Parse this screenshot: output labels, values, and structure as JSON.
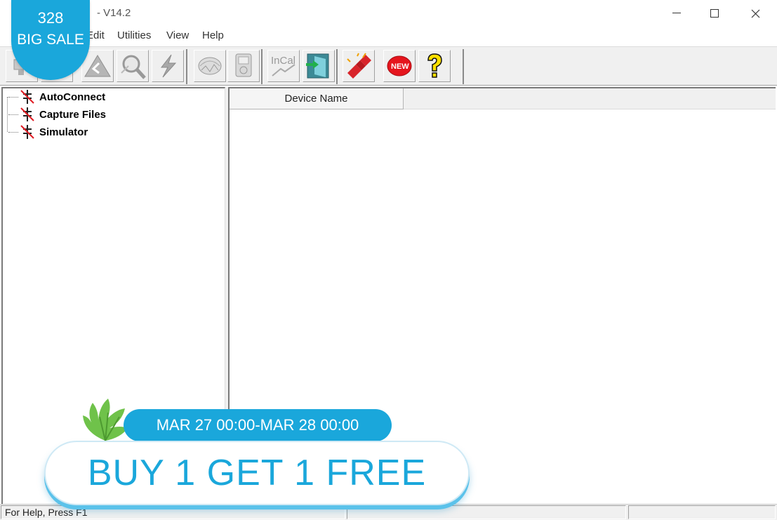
{
  "window": {
    "title": "- V14.2"
  },
  "menu": {
    "items": [
      "Edit",
      "Utilities",
      "View",
      "Help"
    ]
  },
  "toolbar": {
    "buttons": [
      "device-icon",
      "triangle-icon",
      "search-device-icon",
      "lightning-icon",
      "tape-icon",
      "meter-icon",
      "incal-icon",
      "exit-door-icon",
      "connect-icon",
      "new-icon",
      "help-icon"
    ],
    "incal_label": "InCal",
    "new_label": "NEW"
  },
  "tree": {
    "items": [
      {
        "label": "AutoConnect"
      },
      {
        "label": "Capture Files"
      },
      {
        "label": "Simulator"
      }
    ]
  },
  "list": {
    "columns": [
      "Device Name"
    ]
  },
  "status": {
    "text": "For Help, Press F1"
  },
  "promo": {
    "badge_number": "328",
    "badge_text": "BIG SALE",
    "date_range": "MAR 27 00:00-MAR 28 00:00",
    "headline": "BUY 1 GET 1 FREE",
    "accent_color": "#1aa7db"
  }
}
